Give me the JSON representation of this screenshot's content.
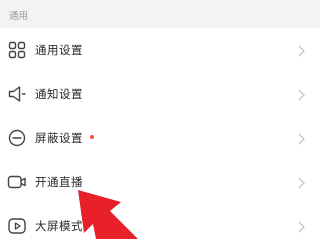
{
  "section": {
    "title": "通用"
  },
  "items": [
    {
      "label": "通用设置",
      "icon": "grid-icon"
    },
    {
      "label": "通知设置",
      "icon": "speaker-icon"
    },
    {
      "label": "屏蔽设置",
      "icon": "block-icon",
      "has_dot": true
    },
    {
      "label": "开通直播",
      "icon": "video-camera-icon"
    },
    {
      "label": "大屏模式",
      "icon": "play-icon"
    }
  ],
  "colors": {
    "background": "#f3f3f5",
    "row_background": "#ffffff",
    "text": "#2a2a2a",
    "icon": "#444444",
    "chevron": "#c8c8c8",
    "section_text": "#9a9a9a",
    "badge_dot": "#f0552f",
    "annotation_arrow": "#e8202a"
  }
}
